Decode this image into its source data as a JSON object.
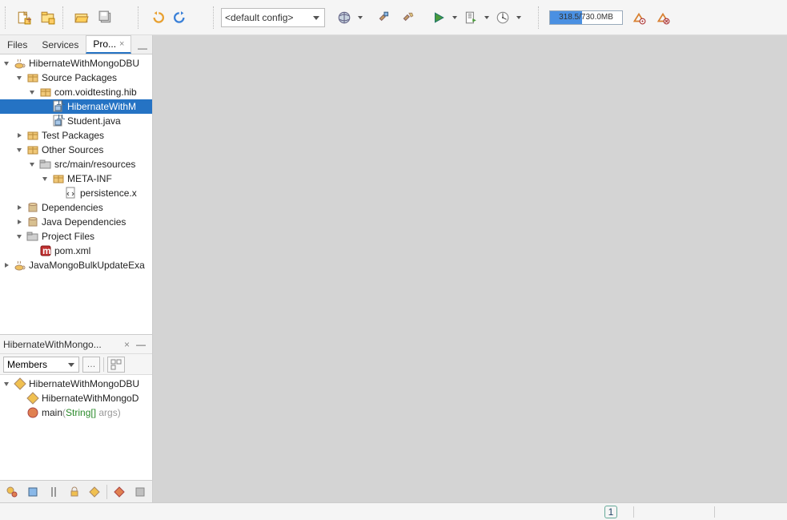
{
  "toolbar": {
    "config_combo": "<default config>",
    "memory": "318.5/730.0MB"
  },
  "tabs": {
    "items": [
      "Files",
      "Services",
      "Pro..."
    ],
    "active_index": 2
  },
  "tree": [
    {
      "indent": 0,
      "twisty": "exp",
      "icon": "coffee",
      "label": "HibernateWithMongoDBU"
    },
    {
      "indent": 1,
      "twisty": "exp",
      "icon": "package",
      "label": "Source Packages"
    },
    {
      "indent": 2,
      "twisty": "exp",
      "icon": "package",
      "label": "com.voidtesting.hib"
    },
    {
      "indent": 3,
      "twisty": "none",
      "icon": "javaclass",
      "label": "HibernateWithM",
      "selected": true
    },
    {
      "indent": 3,
      "twisty": "none",
      "icon": "javaclass",
      "label": "Student.java"
    },
    {
      "indent": 1,
      "twisty": "col",
      "icon": "package",
      "label": "Test Packages"
    },
    {
      "indent": 1,
      "twisty": "exp",
      "icon": "package",
      "label": "Other Sources"
    },
    {
      "indent": 2,
      "twisty": "exp",
      "icon": "folder",
      "label": "src/main/resources"
    },
    {
      "indent": 3,
      "twisty": "exp",
      "icon": "package",
      "label": "META-INF"
    },
    {
      "indent": 4,
      "twisty": "none",
      "icon": "xml",
      "label": "persistence.x"
    },
    {
      "indent": 1,
      "twisty": "col",
      "icon": "jar",
      "label": "Dependencies"
    },
    {
      "indent": 1,
      "twisty": "col",
      "icon": "jar",
      "label": "Java Dependencies"
    },
    {
      "indent": 1,
      "twisty": "exp",
      "icon": "folder",
      "label": "Project Files"
    },
    {
      "indent": 2,
      "twisty": "none",
      "icon": "maven",
      "label": "pom.xml"
    },
    {
      "indent": 0,
      "twisty": "col",
      "icon": "coffee",
      "label": "JavaMongoBulkUpdateExa"
    }
  ],
  "navigator": {
    "title": "HibernateWithMongo...",
    "combo": "Members",
    "tree": [
      {
        "indent": 0,
        "twisty": "exp",
        "icon": "class",
        "label": "HibernateWithMongoDBU"
      },
      {
        "indent": 1,
        "twisty": "none",
        "icon": "constructor",
        "label": "HibernateWithMongoD"
      },
      {
        "indent": 1,
        "twisty": "none",
        "icon": "method",
        "label": "main",
        "params": "(String[] args)"
      }
    ]
  },
  "status": {
    "notif_count": "1"
  }
}
